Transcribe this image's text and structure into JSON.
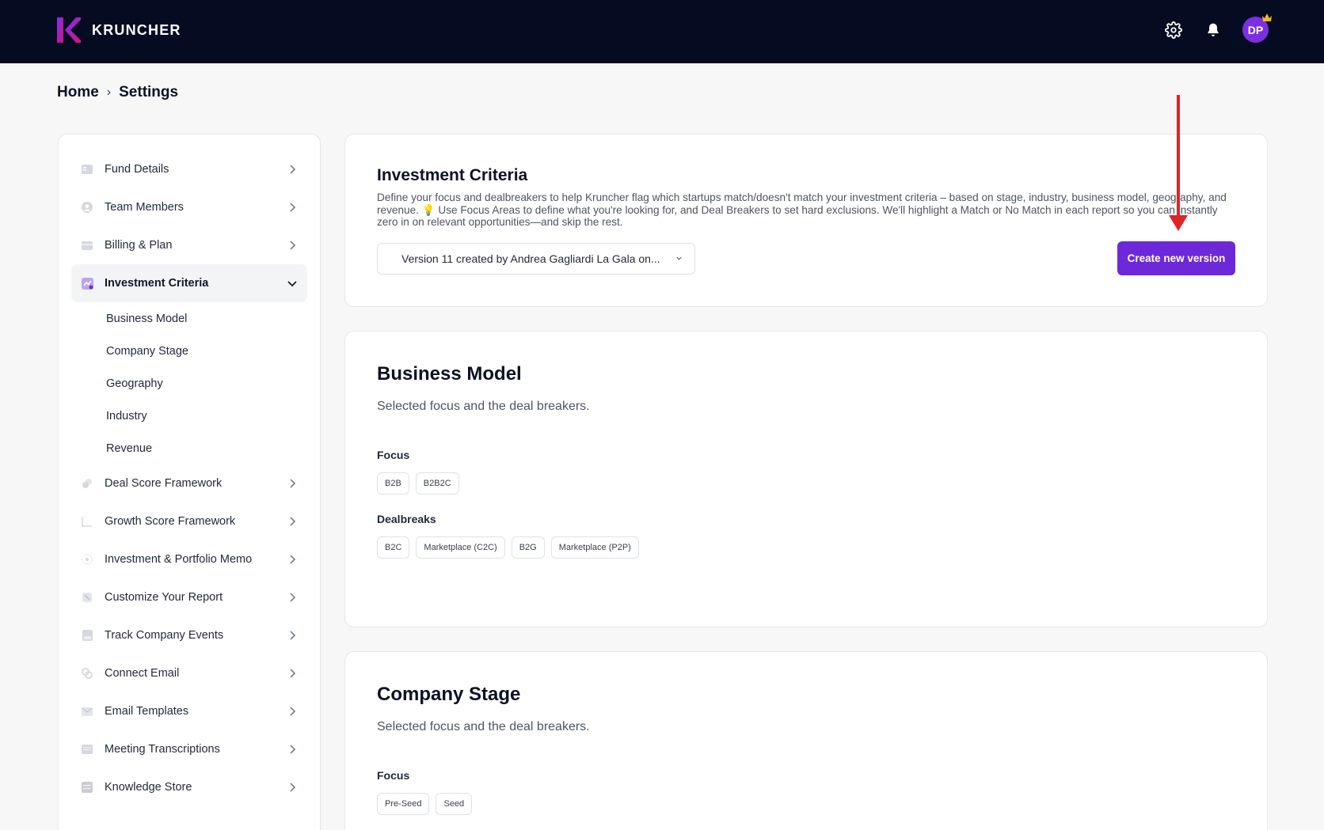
{
  "app": {
    "brand_name": "KRUNCHER",
    "user_initials": "DP"
  },
  "breadcrumb": {
    "home": "Home",
    "separator": "›",
    "current": "Settings"
  },
  "sidebar": {
    "items": [
      {
        "label": "Fund Details",
        "icon": "id-card-icon"
      },
      {
        "label": "Team Members",
        "icon": "user-icon"
      },
      {
        "label": "Billing & Plan",
        "icon": "credit-card-icon"
      },
      {
        "label": "Investment Criteria",
        "icon": "criteria-icon",
        "active": true
      },
      {
        "label": "Deal Score Framework",
        "icon": "score-icon"
      },
      {
        "label": "Growth Score Framework",
        "icon": "chart-line-icon"
      },
      {
        "label": "Investment & Portfolio Memo",
        "icon": "memo-icon"
      },
      {
        "label": "Customize Your Report",
        "icon": "report-icon"
      },
      {
        "label": "Track Company Events",
        "icon": "events-icon"
      },
      {
        "label": "Connect Email",
        "icon": "link-icon"
      },
      {
        "label": "Email Templates",
        "icon": "envelope-icon"
      },
      {
        "label": "Meeting Transcriptions",
        "icon": "transcript-icon"
      },
      {
        "label": "Knowledge Store",
        "icon": "database-icon"
      }
    ],
    "subitems": [
      "Business Model",
      "Company Stage",
      "Geography",
      "Industry",
      "Revenue"
    ]
  },
  "criteria": {
    "title": "Investment Criteria",
    "description": "Define your focus and dealbreakers to help Kruncher flag which startups match/doesn't match your investment criteria – based on stage, industry, business model, geography, and revenue. 💡 Use Focus Areas to define what you're looking for, and Deal Breakers to set hard exclusions. We'll highlight a Match or No Match in each report so you can instantly zero in on relevant opportunities—and skip the rest.",
    "version_label": "Version 11 created by Andrea Gagliardi La Gala on...",
    "create_button": "Create new version"
  },
  "business_model": {
    "title": "Business Model",
    "subtitle": "Selected focus and the deal breakers.",
    "focus_label": "Focus",
    "focus": [
      "B2B",
      "B2B2C"
    ],
    "dealbreaks_label": "Dealbreaks",
    "dealbreaks": [
      "B2C",
      "Marketplace (C2C)",
      "B2G",
      "Marketplace (P2P)"
    ]
  },
  "company_stage": {
    "title": "Company Stage",
    "subtitle": "Selected focus and the deal breakers.",
    "focus_label": "Focus",
    "focus": [
      "Pre-Seed",
      "Seed"
    ]
  },
  "colors": {
    "topbar": "#050c21",
    "accent": "#6d28d9",
    "brand_logo": "#b5179e",
    "annotation_arrow": "#e02424"
  }
}
